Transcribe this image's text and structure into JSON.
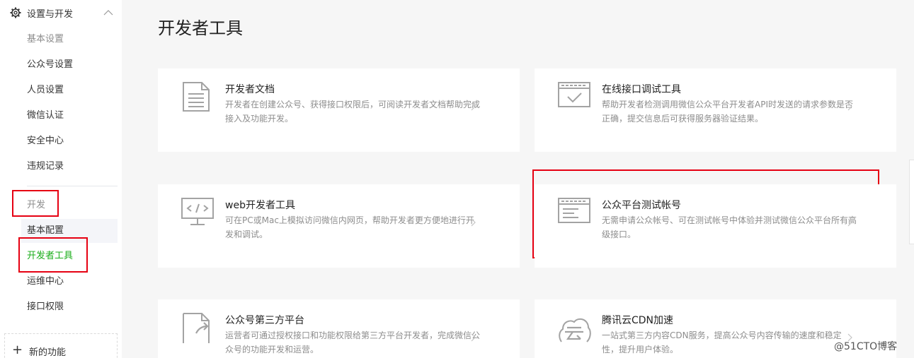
{
  "sidebar": {
    "section_title": "设置与开发",
    "items": [
      {
        "label": "基本设置"
      },
      {
        "label": "公众号设置"
      },
      {
        "label": "人员设置"
      },
      {
        "label": "微信认证"
      },
      {
        "label": "安全中心"
      },
      {
        "label": "违规记录"
      },
      {
        "label": "开发"
      },
      {
        "label": "基本配置"
      },
      {
        "label": "开发者工具"
      },
      {
        "label": "运维中心"
      },
      {
        "label": "接口权限"
      }
    ],
    "new_function": "新的功能"
  },
  "page": {
    "title": "开发者工具"
  },
  "cards": [
    {
      "title": "开发者文档",
      "desc": "开发者在创建公众号、获得接口权限后，可阅读开发者文档帮助完成接入及功能开发。",
      "icon": "document-icon"
    },
    {
      "title": "在线接口调试工具",
      "desc": "帮助开发者检测调用微信公众平台开发者API时发送的请求参数是否正确，提交信息后可获得服务器验证结果。",
      "icon": "debug-window-icon"
    },
    {
      "title": "web开发者工具",
      "desc": "可在PC或Mac上模拟访问微信内网页，帮助开发者更方便地进行开发和调试。",
      "icon": "code-monitor-icon"
    },
    {
      "title": "公众平台测试帐号",
      "desc": "无需申请公众帐号、可在测试帐号中体验并测试微信公众平台所有高级接口。",
      "icon": "test-account-window-icon"
    },
    {
      "title": "公众号第三方平台",
      "desc": "运营者可通过授权接口和功能权限给第三方平台开发者，完成微信公众号的功能开发和运营。",
      "icon": "third-party-doc-icon"
    },
    {
      "title": "腾讯云CDN加速",
      "desc": "一站式第三方内容CDN服务，提高公众号内容传输的速度和稳定性，提升用户体验。",
      "icon": "cloud-icon"
    }
  ],
  "watermark": "@51CTO博客",
  "colors": {
    "accent_green": "#1aad19",
    "highlight_red": "#e60012",
    "icon_gray": "#a3a3a3"
  }
}
